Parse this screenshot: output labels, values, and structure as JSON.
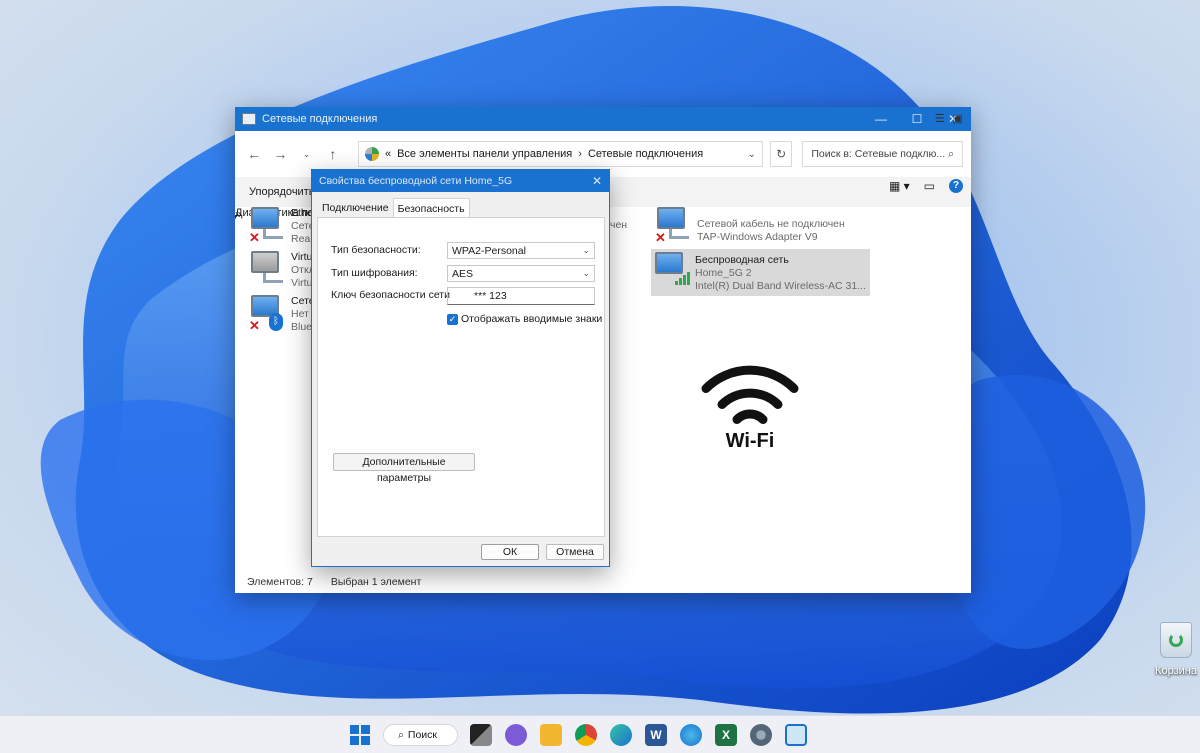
{
  "explorer": {
    "title": "Сетевые подключения",
    "address_path": [
      "Все элементы панели управления",
      "Сетевые подключения"
    ],
    "address_prefix": "«",
    "search_placeholder": "Поиск в: Сетевые подклю...",
    "toolbar": {
      "organize": "Упорядочить",
      "organize_arrow": "▾",
      "diagnostics": "Диагностика подключения",
      "more": "»"
    },
    "connections_left": [
      {
        "name": "Ethe",
        "line1": "Сете",
        "line2": "Realt",
        "state": "disconnected"
      },
      {
        "name": "Virtu",
        "line1": "Откл",
        "line2": "Virtu",
        "state": "disabled"
      },
      {
        "name": "Сете",
        "line1": "Нет",
        "line2": "Blue",
        "state": "bluetooth"
      }
    ],
    "middle_fragment": "чен",
    "connections_right": [
      {
        "name": "Сетевой кабель не подключен",
        "line1": "TAP-Windows Adapter V9",
        "state": "disconnected"
      },
      {
        "name": "Беспроводная сеть",
        "line1": "Home_5G 2",
        "line2": "Intel(R) Dual Band Wireless-AC 31...",
        "state": "wireless"
      }
    ],
    "status": {
      "count": "Элементов: 7",
      "selected": "Выбран 1 элемент"
    }
  },
  "dialog": {
    "title": "Свойства беспроводной сети Home_5G",
    "close": "✕",
    "tabs": [
      "Подключение",
      "Безопасность"
    ],
    "active_tab": "Безопасность",
    "security_type_label": "Тип безопасности:",
    "security_type_value": "WPA2-Personal",
    "encryption_type_label": "Тип шифрования:",
    "encryption_type_value": "AES",
    "key_label": "Ключ безопасности сети",
    "key_value": "***  123",
    "show_chars_label": "Отображать вводимые знаки",
    "show_chars_checked": true,
    "advanced_button": "Дополнительные параметры",
    "ok_button": "ОК",
    "cancel_button": "Отмена"
  },
  "overlay": {
    "wifi_text": "Wi-Fi"
  },
  "desktop": {
    "recycle_bin": "Корзина"
  },
  "taskbar": {
    "search_label": "Поиск"
  },
  "colors": {
    "accent": "#1a72d0",
    "wallpaper_blue": "#1d5fe0"
  }
}
